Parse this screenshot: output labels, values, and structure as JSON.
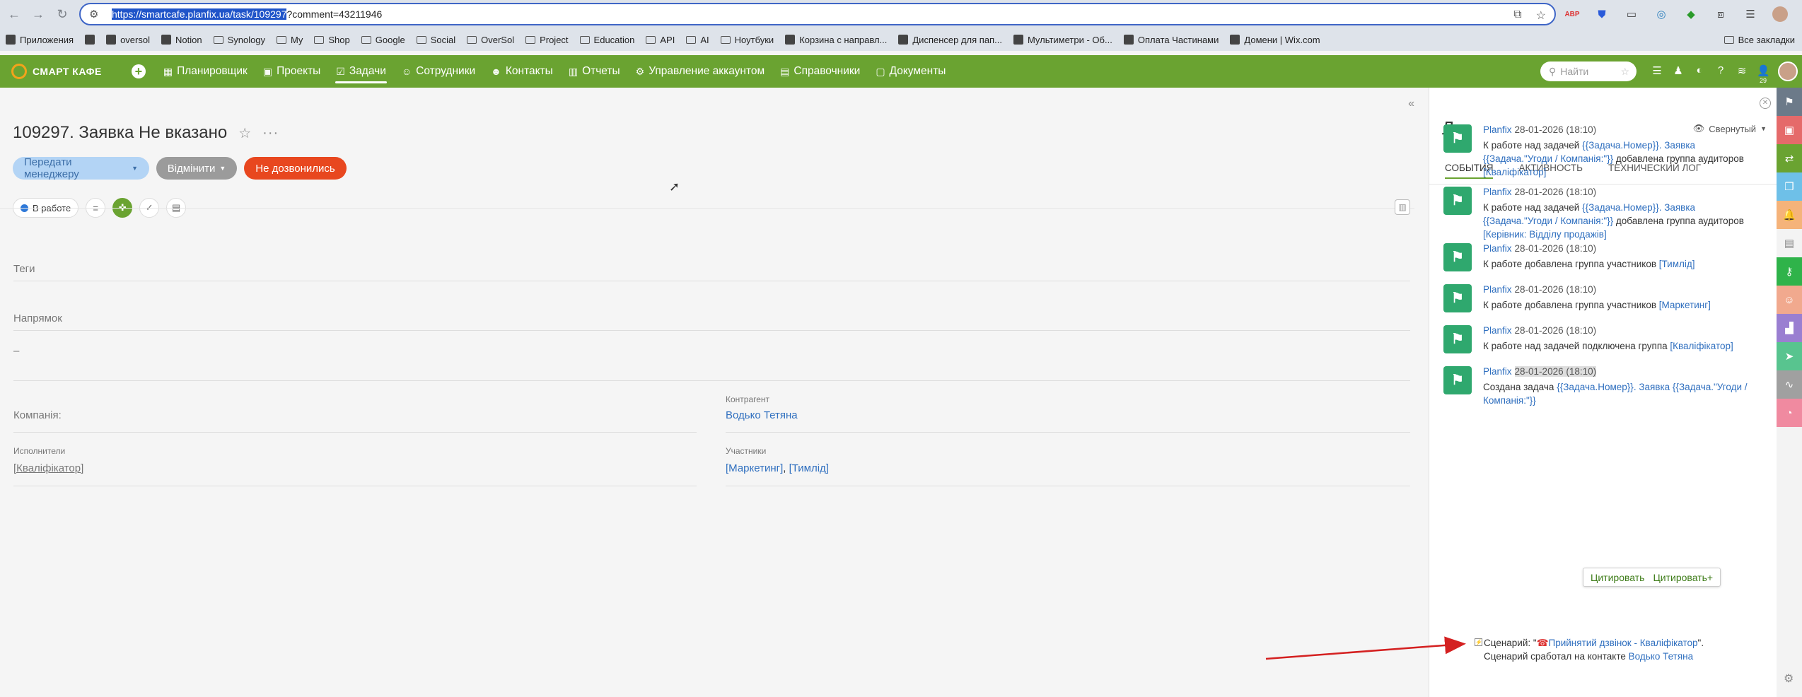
{
  "browser": {
    "back": "←",
    "forward": "→",
    "reload": "↻",
    "url_selected": "https://smartcafe.planfix.ua/task/109297",
    "url_rest": "?comment=43211946",
    "bookmarks": [
      {
        "label": "Приложения",
        "icon": "apps-icon"
      },
      {
        "label": "",
        "icon": "grid-icon"
      },
      {
        "label": "oversol",
        "icon": "site-icon"
      },
      {
        "label": "Notion",
        "icon": "notion-icon"
      },
      {
        "label": "Synology",
        "icon": "folder-icon"
      },
      {
        "label": "My",
        "icon": "folder-icon"
      },
      {
        "label": "Shop",
        "icon": "folder-icon"
      },
      {
        "label": "Google",
        "icon": "folder-icon"
      },
      {
        "label": "Social",
        "icon": "folder-icon"
      },
      {
        "label": "OverSol",
        "icon": "folder-icon"
      },
      {
        "label": "Project",
        "icon": "folder-icon"
      },
      {
        "label": "Education",
        "icon": "folder-icon"
      },
      {
        "label": "API",
        "icon": "folder-icon"
      },
      {
        "label": "AI",
        "icon": "folder-icon"
      },
      {
        "label": "Ноутбуки",
        "icon": "folder-icon"
      },
      {
        "label": "Корзина с направл...",
        "icon": "site-icon"
      },
      {
        "label": "Диспенсер для пап...",
        "icon": "site-icon"
      },
      {
        "label": "Мультиметри - Об...",
        "icon": "site-icon"
      },
      {
        "label": "Оплата Частинами",
        "icon": "site-icon"
      },
      {
        "label": "Домени | Wix.com",
        "icon": "site-icon"
      }
    ],
    "all_bookmarks": "Все закладки"
  },
  "app": {
    "brand": "СМАРТ КАФЕ",
    "menu": [
      {
        "label": "Планировщик",
        "icon": "calendar-icon",
        "active": false
      },
      {
        "label": "Проекты",
        "icon": "briefcase-icon",
        "active": false
      },
      {
        "label": "Задачи",
        "icon": "task-icon",
        "active": true
      },
      {
        "label": "Сотрудники",
        "icon": "people-icon",
        "active": false
      },
      {
        "label": "Контакты",
        "icon": "contact-icon",
        "active": false
      },
      {
        "label": "Отчеты",
        "icon": "report-icon",
        "active": false
      },
      {
        "label": "Управление аккаунтом",
        "icon": "account-icon",
        "active": false
      },
      {
        "label": "Справочники",
        "icon": "book-icon",
        "active": false
      },
      {
        "label": "Документы",
        "icon": "document-icon",
        "active": false
      }
    ],
    "search_placeholder": "Найти",
    "notif_count": "29"
  },
  "task": {
    "title": "109297. Заявка Не вказано",
    "btn_transfer": "Передати менеджеру",
    "btn_cancel": "Відмінити",
    "btn_no_answer": "Не дозвонились",
    "status": "В работе",
    "tags_label": "Теги",
    "direction_label": "Напрямок",
    "dash": "–",
    "company_label": "Компанія:",
    "counterparty_label": "Контрагент",
    "counterparty_value": "Водько Тетяна",
    "executors_label": "Исполнители",
    "executors_value": "[Кваліфікатор]",
    "participants_label": "Участники",
    "participants_value_1": "[Маркетинг]",
    "participants_sep": ", ",
    "participants_value_2": "[Тимлід]"
  },
  "log": {
    "title": "Лог",
    "view_mode": "Свернутый",
    "tabs": [
      "СОБЫТИЯ",
      "АКТИВНОСТЬ",
      "ТЕХНИЧЕСКИЙ ЛОГ"
    ],
    "entries": [
      {
        "who": "Planfix",
        "when": "28-01-2026 (18:10)",
        "pre": "К работе над задачей ",
        "link1": "{{Задача.Номер}}. Заявка {{Задача.\"Угоди / Компанія:\"}}",
        "mid": " добавлена группа аудиторов ",
        "link2": "[Кваліфікатор]"
      },
      {
        "who": "Planfix",
        "when": "28-01-2026 (18:10)",
        "pre": "К работе над задачей ",
        "link1": "{{Задача.Номер}}. Заявка {{Задача.\"Угоди / Компанія:\"}}",
        "mid": " добавлена группа аудиторов ",
        "link2": "[Керівник: Відділу продажів]"
      },
      {
        "who": "Planfix",
        "when": "28-01-2026 (18:10)",
        "pre": "К работе добавлена группа участников ",
        "link1": "[Тимлід]",
        "mid": "",
        "link2": ""
      },
      {
        "who": "Planfix",
        "when": "28-01-2026 (18:10)",
        "pre": "К работе добавлена группа участников ",
        "link1": "[Маркетинг]",
        "mid": "",
        "link2": ""
      },
      {
        "who": "Planfix",
        "when": "28-01-2026 (18:10)",
        "pre": "К работе над задачей    подключена группа ",
        "link1": "[Кваліфікатор]",
        "mid": "",
        "link2": ""
      },
      {
        "who": "Planfix",
        "when": "28-01-2026 (18:10)",
        "pre": "Создана задача ",
        "link1": "{{Задача.Номер}}. Заявка {{Задача.\"Угоди / Компанія:\"}}",
        "mid": "",
        "link2": ""
      }
    ],
    "tooltip_quote": "Цитировать",
    "tooltip_quote_plus": "Цитировать+",
    "scenario_prefix": "Сценарий: \"",
    "scenario_name": "Прийнятий дзвінок - Кваліфікатор",
    "scenario_suffix": "\".",
    "scenario_line2": "Сценарий сработал на контакте ",
    "scenario_contact": "Водько Тетяна"
  },
  "colors": {
    "brand_green": "#6aa331",
    "danger": "#e8471f",
    "link": "#2f6fbf",
    "annotation_arrow": "#d42020"
  }
}
